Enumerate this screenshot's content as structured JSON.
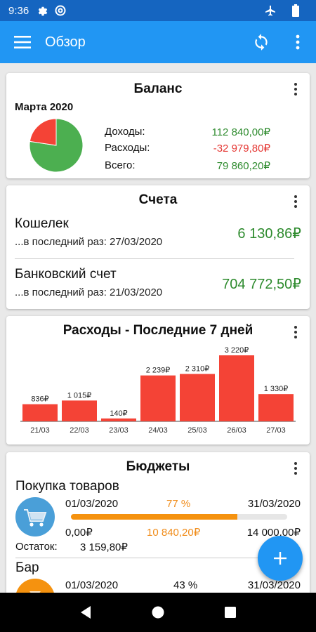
{
  "status_bar": {
    "time": "9:36",
    "icons": [
      "gear-icon",
      "at-sign-icon",
      "airplane-icon",
      "battery-icon"
    ]
  },
  "app_bar": {
    "title": "Обзор",
    "icons": [
      "menu-icon",
      "sync-icon",
      "more-vert-icon"
    ]
  },
  "balance": {
    "title": "Баланс",
    "period": "Марта 2020",
    "income_label": "Доходы:",
    "income_value": "112 840,00₽",
    "expense_label": "Расходы:",
    "expense_value": "-32 979,80₽",
    "total_label": "Всего:",
    "total_value": "79 860,20₽",
    "pie": {
      "income": 112840.0,
      "expense": 32979.8,
      "income_color": "#4caf50",
      "expense_color": "#f44336"
    }
  },
  "accounts": {
    "title": "Счета",
    "items": [
      {
        "name": "Кошелек",
        "last_used": "...в последний раз: 27/03/2020",
        "amount": "6 130,86₽"
      },
      {
        "name": "Банковский счет",
        "last_used": "...в последний раз: 21/03/2020",
        "amount": "704 772,50₽"
      }
    ]
  },
  "expenses": {
    "title": "Расходы - Последние 7 дней"
  },
  "chart_data": {
    "type": "bar",
    "title": "Расходы - Последние 7 дней",
    "categories": [
      "21/03",
      "22/03",
      "23/03",
      "24/03",
      "25/03",
      "26/03",
      "27/03"
    ],
    "values": [
      836,
      1015,
      140,
      2239,
      2310,
      3220,
      1330
    ],
    "data_labels": [
      "836₽",
      "1 015₽",
      "140₽",
      "2 239₽",
      "2 310₽",
      "3 220₽",
      "1 330₽"
    ],
    "ylim": [
      0,
      3220
    ],
    "bar_color": "#f44336",
    "grid": false
  },
  "budgets": {
    "title": "Бюджеты",
    "items": [
      {
        "name": "Покупка товаров",
        "icon": "shopping-cart-icon",
        "icon_color": "#4a9fd8",
        "start": "01/03/2020",
        "end": "31/03/2020",
        "percent_label": "77 %",
        "progress": 0.77,
        "min": "0,00₽",
        "spent": "10 840,20₽",
        "limit": "14 000,00₽",
        "remaining_label": "Остаток:",
        "remaining_value": "3 159,80₽"
      },
      {
        "name": "Бар",
        "icon": "bar-icon",
        "icon_color": "#f5920f",
        "start": "01/03/2020",
        "end": "31/03/2020",
        "percent_label": "43 %",
        "progress": 0.43
      }
    ]
  },
  "fab": {
    "icon": "plus-icon"
  },
  "nav_bar": {
    "icons": [
      "back-icon",
      "home-icon",
      "recents-icon"
    ]
  }
}
